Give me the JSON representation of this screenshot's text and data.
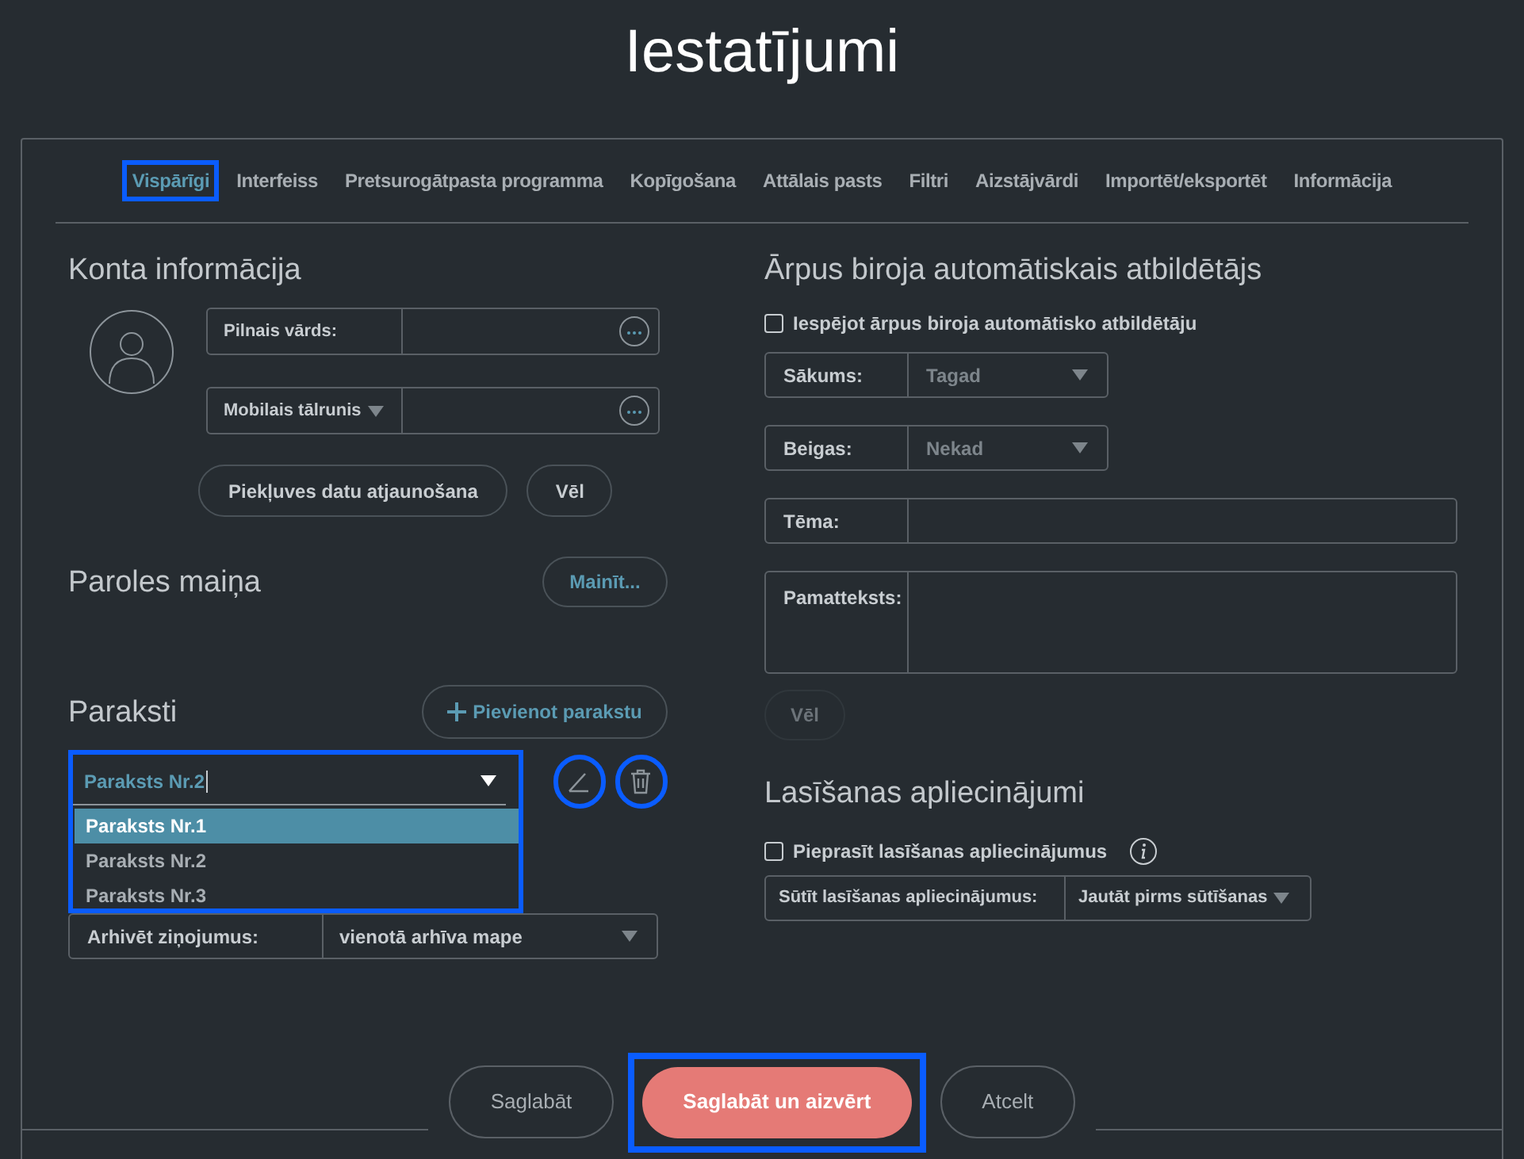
{
  "title": "Iestatījumi",
  "tabs": [
    {
      "label": "Vispārīgi",
      "selected": true,
      "highlighted": true
    },
    {
      "label": "Interfeiss",
      "selected": false,
      "highlighted": false
    },
    {
      "label": "Pretsurogātpasta programma",
      "selected": false,
      "highlighted": false
    },
    {
      "label": "Kopīgošana",
      "selected": false,
      "highlighted": false
    },
    {
      "label": "Attālais pasts",
      "selected": false,
      "highlighted": false
    },
    {
      "label": "Filtri",
      "selected": false,
      "highlighted": false
    },
    {
      "label": "Aizstājvārdi",
      "selected": false,
      "highlighted": false
    },
    {
      "label": "Importēt/eksportēt",
      "selected": false,
      "highlighted": false
    },
    {
      "label": "Informācija",
      "selected": false,
      "highlighted": false
    }
  ],
  "account": {
    "heading": "Konta informācija",
    "fields": [
      {
        "label": "Pilnais vārds:",
        "kind": "text"
      },
      {
        "label": "Mobilais tālrunis",
        "kind": "select"
      }
    ],
    "buttons": [
      "Piekļuves datu atjaunošana",
      "Vēl"
    ]
  },
  "password": {
    "heading": "Paroles maiņa",
    "button": "Mainīt..."
  },
  "signatures": {
    "heading": "Paraksti",
    "add_button": "Pievienot parakstu",
    "value": "Paraksts Nr.2",
    "expanded": true,
    "highlighted": true,
    "edit_highlighted": true,
    "delete_highlighted": true,
    "options": [
      {
        "label": "Paraksts Nr.1",
        "hovered": true
      },
      {
        "label": "Paraksts Nr.2",
        "hovered": false
      },
      {
        "label": "Paraksts Nr.3",
        "hovered": false
      }
    ]
  },
  "archive": {
    "label": "Arhivēt ziņojumus:",
    "value": "vienotā arhīva mape"
  },
  "out_of_office": {
    "heading": "Ārpus biroja automātiskais atbildētājs",
    "enable": {
      "label": "Iespējot ārpus biroja automātisko atbildētāju",
      "checked": false
    },
    "fields": [
      {
        "label": "Sākums:",
        "value": "Tagad",
        "kind": "select",
        "disabled": true
      },
      {
        "label": "Beigas:",
        "value": "Nekad",
        "kind": "select",
        "disabled": true
      },
      {
        "label": "Tēma:",
        "kind": "text"
      },
      {
        "label": "Pamatteksts:",
        "kind": "textarea"
      }
    ],
    "more_button": {
      "label": "Vēl",
      "disabled": true
    }
  },
  "read_receipts": {
    "heading": "Lasīšanas apliecinājumi",
    "request": {
      "label": "Pieprasīt lasīšanas apliecinājumus",
      "checked": false
    },
    "send": {
      "label": "Sūtīt lasīšanas apliecinājumus:",
      "value": "Jautāt pirms sūtīšanas"
    }
  },
  "footer": [
    {
      "label": "Saglabāt",
      "kind": "secondary",
      "highlighted": false
    },
    {
      "label": "Saglabāt un aizvērt",
      "kind": "primary",
      "highlighted": true
    },
    {
      "label": "Atcelt",
      "kind": "secondary",
      "highlighted": false
    }
  ]
}
